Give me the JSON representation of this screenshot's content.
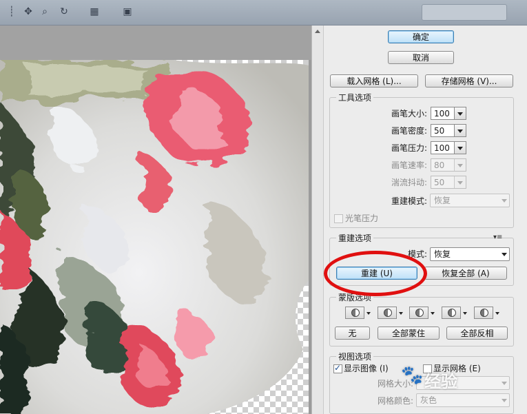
{
  "dialog": {
    "ok_label": "确定",
    "cancel_label": "取消",
    "load_mesh_label": "载入网格 (L)...",
    "save_mesh_label": "存储网格 (V)..."
  },
  "tool_options": {
    "title": "工具选项",
    "brush_size": {
      "label": "画笔大小:",
      "value": "100"
    },
    "brush_density": {
      "label": "画笔密度:",
      "value": "50"
    },
    "brush_pressure": {
      "label": "画笔压力:",
      "value": "100"
    },
    "brush_rate": {
      "label": "画笔速率:",
      "value": "80"
    },
    "turbulent_jitter": {
      "label": "湍流抖动:",
      "value": "50"
    },
    "reconstruct_mode": {
      "label": "重建模式:",
      "value": "恢复"
    },
    "stylus_pressure": "光笔压力"
  },
  "reconstruct_options": {
    "title": "重建选项",
    "mode_label": "模式:",
    "mode_value": "恢复",
    "reconstruct_label": "重建 (U)",
    "restore_all_label": "恢复全部 (A)"
  },
  "mask_options": {
    "title": "蒙版选项",
    "none_label": "无",
    "mask_all_label": "全部蒙住",
    "invert_all_label": "全部反相"
  },
  "view_options": {
    "title": "视图选项",
    "show_image_label": "显示图像 (I)",
    "show_image_checked": true,
    "show_mesh_label": "显示网格 (E)",
    "show_mesh_checked": false,
    "mesh_size_label": "网格大小:",
    "mesh_size_value": "",
    "mesh_color_label": "网格颜色:",
    "mesh_color_value": "灰色"
  },
  "watermark": {
    "text": "经验",
    "icon": "paw-icon"
  },
  "colors": {
    "highlight_ring": "#e01010",
    "primary_button": "#bfe1f8"
  }
}
